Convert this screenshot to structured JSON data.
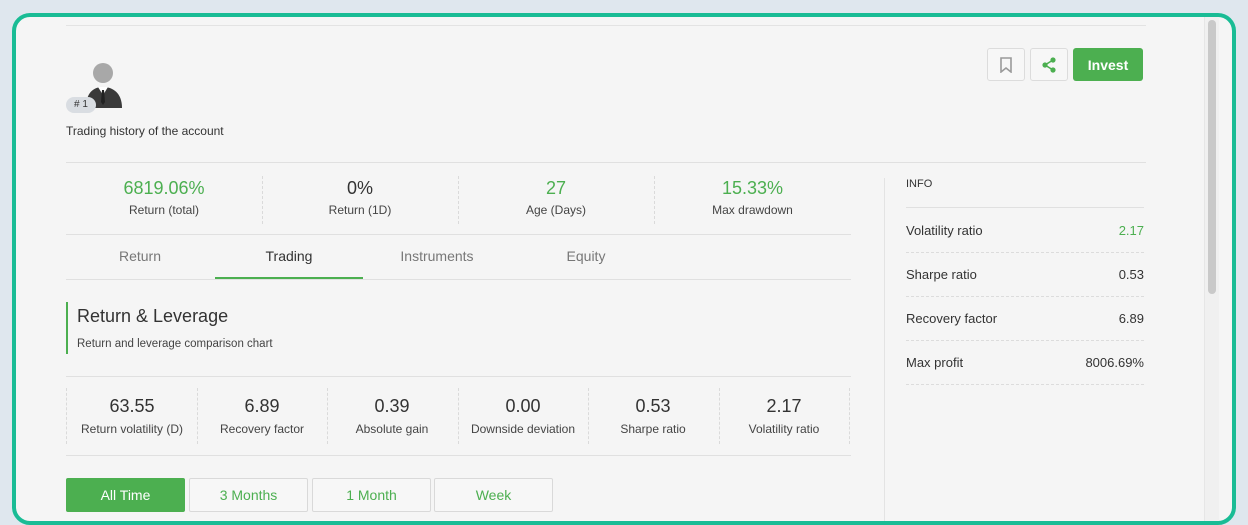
{
  "header": {
    "rank": "# 1",
    "subtitle": "Trading history of the account",
    "invest_label": "Invest"
  },
  "stats": [
    {
      "value": "6819.06%",
      "label": "Return (total)"
    },
    {
      "value": "0%",
      "label": "Return (1D)"
    },
    {
      "value": "27",
      "label": "Age (Days)"
    },
    {
      "value": "15.33%",
      "label": "Max drawdown"
    }
  ],
  "tabs": [
    "Return",
    "Trading",
    "Instruments",
    "Equity"
  ],
  "active_tab": "Trading",
  "section": {
    "title": "Return & Leverage",
    "description": "Return and leverage comparison chart"
  },
  "metrics": [
    {
      "value": "63.55",
      "label": "Return volatility (D)"
    },
    {
      "value": "6.89",
      "label": "Recovery factor"
    },
    {
      "value": "0.39",
      "label": "Absolute gain"
    },
    {
      "value": "0.00",
      "label": "Downside deviation"
    },
    {
      "value": "0.53",
      "label": "Sharpe ratio"
    },
    {
      "value": "2.17",
      "label": "Volatility ratio"
    }
  ],
  "periods": [
    "All Time",
    "3 Months",
    "1 Month",
    "Week"
  ],
  "active_period": "All Time",
  "info": {
    "title": "INFO",
    "rows": [
      {
        "label": "Volatility ratio",
        "value": "2.17"
      },
      {
        "label": "Sharpe ratio",
        "value": "0.53"
      },
      {
        "label": "Recovery factor",
        "value": "6.89"
      },
      {
        "label": "Max profit",
        "value": "8006.69%"
      }
    ]
  },
  "colors": {
    "accent": "#4caf50",
    "frame": "#19bc95"
  },
  "icons": [
    "avatar-icon",
    "bookmark-icon",
    "share-icon"
  ]
}
